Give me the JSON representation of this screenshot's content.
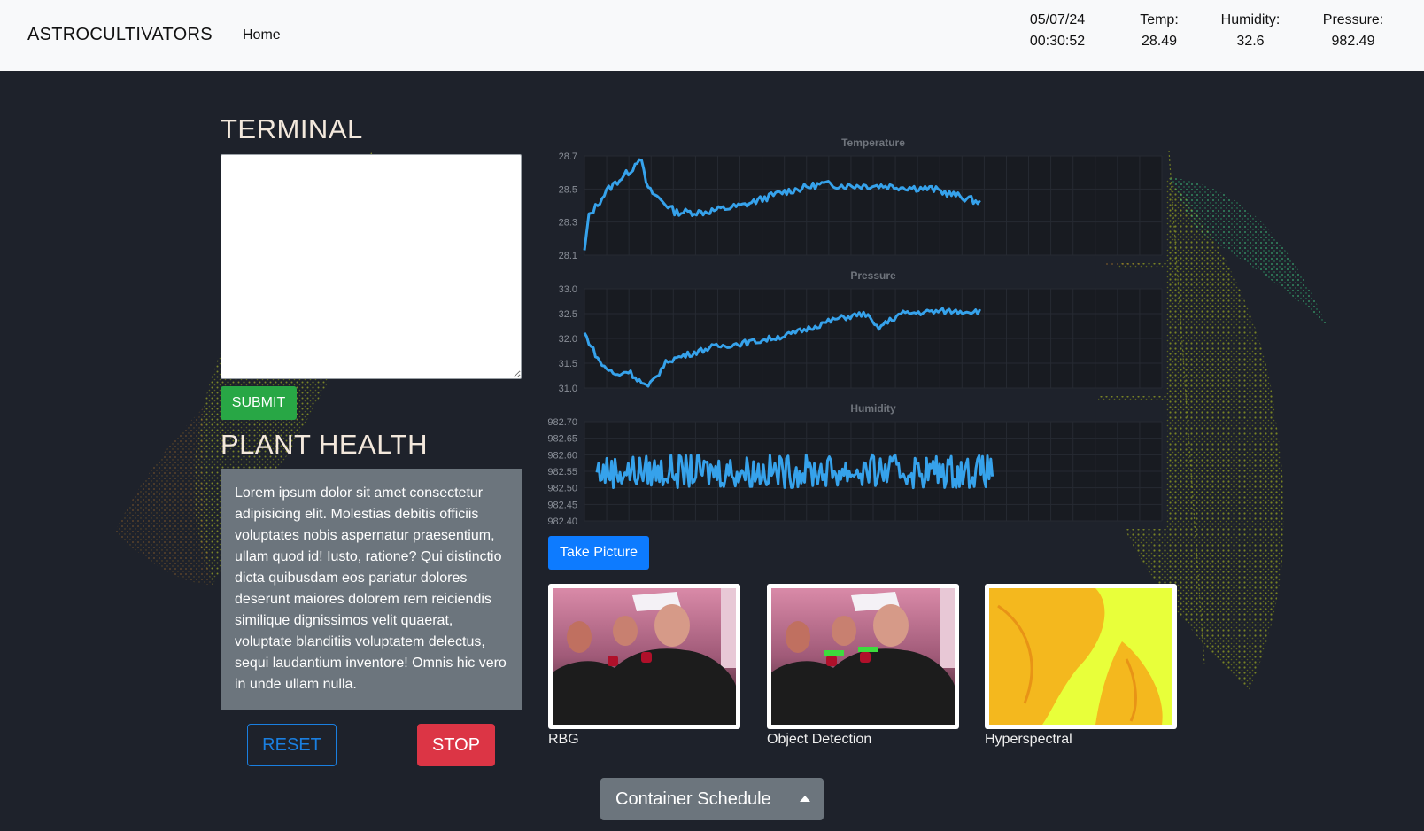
{
  "nav": {
    "brand": "ASTROCULTIVATORS",
    "home": "Home",
    "date": "05/07/24",
    "time": "00:30:52",
    "temp_label": "Temp:",
    "temp_value": "28.49",
    "humidity_label": "Humidity:",
    "humidity_value": "32.6",
    "pressure_label": "Pressure:",
    "pressure_value": "982.49"
  },
  "terminal": {
    "title": "TERMINAL",
    "value": "",
    "submit_label": "SUBMIT"
  },
  "plant_health": {
    "title": "PLANT HEALTH",
    "text": "Lorem ipsum dolor sit amet consectetur adipisicing elit. Molestias debitis officiis voluptates nobis aspernatur praesentium, ullam quod id! Iusto, ratione? Qui distinctio dicta quibusdam eos pariatur dolores deserunt maiores dolorem rem reiciendis similique dignissimos velit quaerat, voluptate blanditiis voluptatem delectus, sequi laudantium inventore! Omnis hic vero in unde ullam nulla."
  },
  "controls": {
    "reset_label": "RESET",
    "stop_label": "STOP"
  },
  "camera": {
    "take_picture_label": "Take Picture",
    "images": [
      {
        "label": "RBG"
      },
      {
        "label": "Object Detection"
      },
      {
        "label": "Hyperspectral"
      }
    ]
  },
  "schedule": {
    "label": "Container Schedule"
  },
  "colors": {
    "line": "#36a2eb",
    "plot_bg": "#181b21",
    "panel_bg": "#1e222b",
    "submit": "#28a745",
    "primary": "#0d7bff",
    "danger": "#dc3545",
    "secondary": "#6c757d"
  },
  "chart_data": [
    {
      "type": "line",
      "title": "Temperature",
      "yticks": [
        "28.7",
        "28.5",
        "28.3",
        "28.1"
      ],
      "ylim": [
        28.1,
        28.7
      ],
      "grid": true,
      "x_count": 180,
      "shape": [
        [
          0,
          28.12
        ],
        [
          0.01,
          28.33
        ],
        [
          0.06,
          28.5
        ],
        [
          0.12,
          28.62
        ],
        [
          0.14,
          28.7
        ],
        [
          0.16,
          28.5
        ],
        [
          0.23,
          28.36
        ],
        [
          0.3,
          28.36
        ],
        [
          0.4,
          28.4
        ],
        [
          0.5,
          28.48
        ],
        [
          0.6,
          28.53
        ],
        [
          0.66,
          28.52
        ],
        [
          0.75,
          28.52
        ],
        [
          0.88,
          28.5
        ],
        [
          1.0,
          28.42
        ]
      ],
      "noise": 0.022
    },
    {
      "type": "line",
      "title": "Pressure",
      "yticks": [
        "33.0",
        "32.5",
        "32.0",
        "31.5",
        "31.0"
      ],
      "ylim": [
        31.0,
        33.0
      ],
      "grid": true,
      "x_count": 180,
      "shape": [
        [
          0,
          32.1
        ],
        [
          0.04,
          31.5
        ],
        [
          0.08,
          31.25
        ],
        [
          0.11,
          31.35
        ],
        [
          0.16,
          31.0
        ],
        [
          0.21,
          31.55
        ],
        [
          0.32,
          31.82
        ],
        [
          0.44,
          31.95
        ],
        [
          0.52,
          32.08
        ],
        [
          0.64,
          32.4
        ],
        [
          0.71,
          32.5
        ],
        [
          0.74,
          32.2
        ],
        [
          0.8,
          32.5
        ],
        [
          0.9,
          32.55
        ],
        [
          1.0,
          32.55
        ]
      ],
      "noise": 0.06
    },
    {
      "type": "line",
      "title": "Humidity",
      "yticks": [
        "982.70",
        "982.65",
        "982.60",
        "982.55",
        "982.50",
        "982.45",
        "982.40"
      ],
      "ylim": [
        982.4,
        982.7
      ],
      "grid": true,
      "x_count": 240,
      "shape": [
        [
          0,
          982.55
        ],
        [
          1.0,
          982.55
        ]
      ],
      "noise": 0.05
    }
  ]
}
